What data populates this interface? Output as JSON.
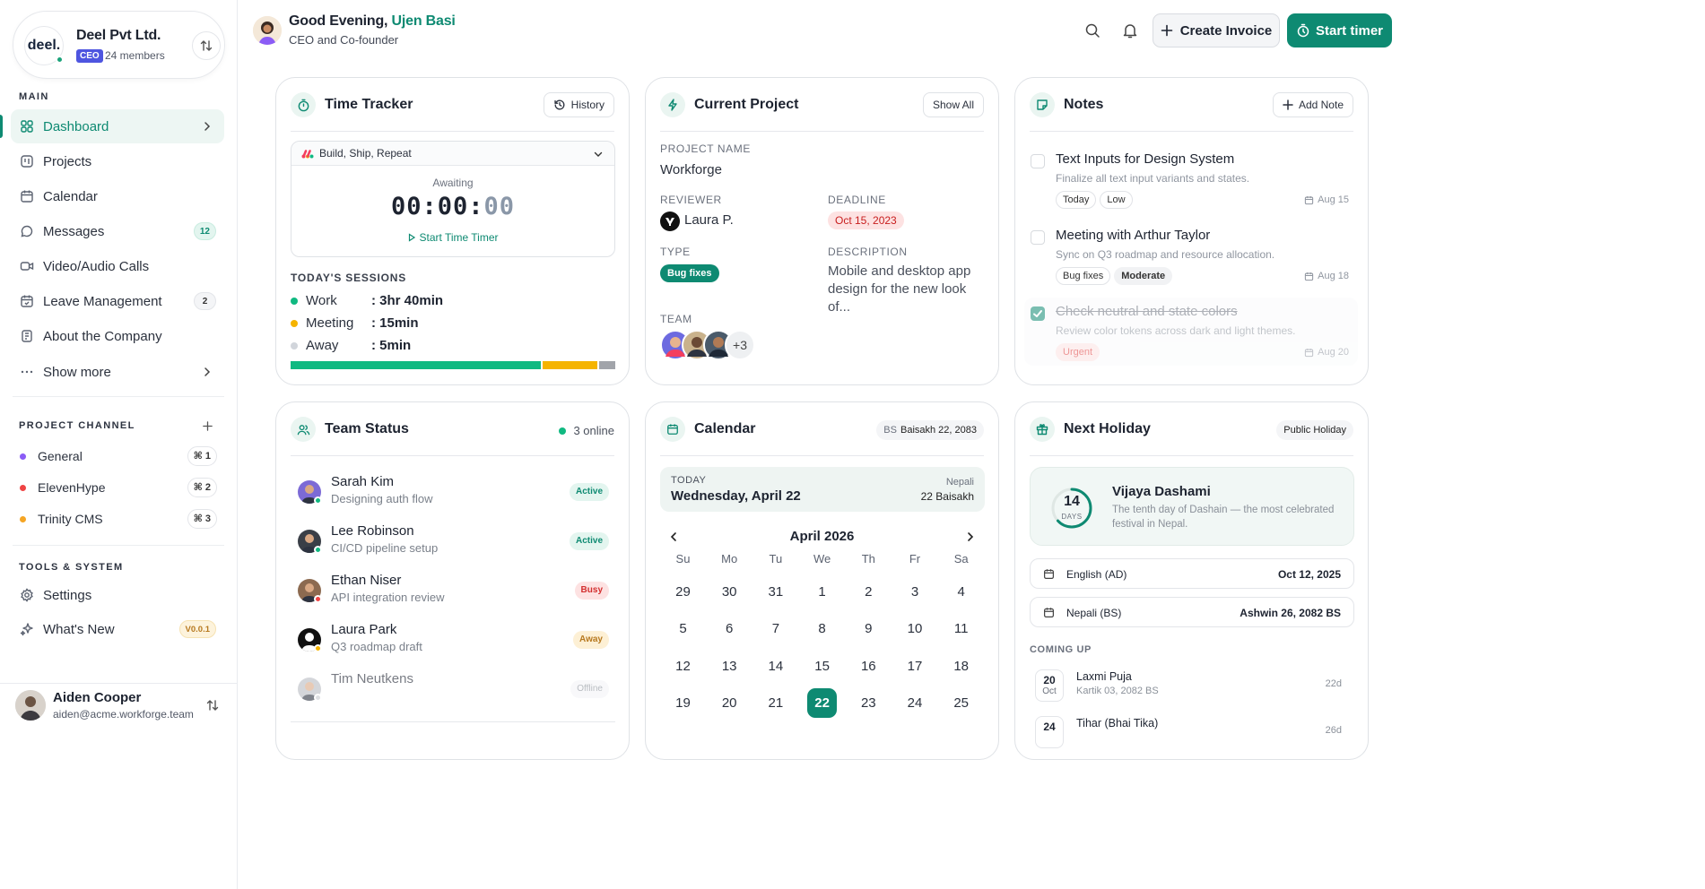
{
  "org": {
    "logo_text": "deel.",
    "name": "Deel Pvt Ltd.",
    "role": "CEO",
    "members": "24 members"
  },
  "sidebar": {
    "main_title": "MAIN",
    "items": [
      {
        "label": "Dashboard",
        "icon": "grid-icon",
        "active": true
      },
      {
        "label": "Projects",
        "icon": "projects-icon"
      },
      {
        "label": "Calendar",
        "icon": "calendar-icon"
      },
      {
        "label": "Messages",
        "icon": "message-icon",
        "badge": "12"
      },
      {
        "label": "Video/Audio Calls",
        "icon": "video-icon"
      },
      {
        "label": "Leave Management",
        "icon": "leave-icon",
        "badge": "2"
      },
      {
        "label": "About the Company",
        "icon": "building-icon"
      },
      {
        "label": "Show more",
        "icon": "more-icon"
      }
    ],
    "channel_title": "PROJECT CHANNEL",
    "channels": [
      {
        "label": "General",
        "color": "#8b5cf6",
        "shortcut": "⌘ 1"
      },
      {
        "label": "ElevenHype",
        "color": "#ef4444",
        "shortcut": "⌘ 2"
      },
      {
        "label": "Trinity CMS",
        "color": "#f5a524",
        "shortcut": "⌘ 3"
      }
    ],
    "tools_title": "TOOLS & SYSTEM",
    "tools": [
      {
        "label": "Settings",
        "icon": "settings-icon"
      },
      {
        "label": "What's New",
        "icon": "sparkle-icon",
        "badge": "V0.0.1"
      }
    ]
  },
  "user": {
    "name": "Aiden Cooper",
    "email": "aiden@acme.workforge.team"
  },
  "header": {
    "greeting": "Good Evening, ",
    "name": "Ujen Basi",
    "subtitle": "CEO and Co-founder",
    "create_invoice": "Create Invoice",
    "start_timer": "Start timer"
  },
  "time_tracker": {
    "title": "Time Tracker",
    "history": "History",
    "project": "Build, Ship, Repeat",
    "status": "Awaiting",
    "timer_main": "00:00:",
    "timer_sec": "00",
    "start_link": "Start Time Timer",
    "sessions_title": "TODAY'S SESSIONS",
    "sessions": [
      {
        "label": "Work",
        "value": ": 3hr 40min",
        "color": "#10b981",
        "fraction": 0.78
      },
      {
        "label": "Meeting",
        "value": ": 15min",
        "color": "#f5b400",
        "fraction": 0.17
      },
      {
        "label": "Away",
        "value": ": 5min",
        "color": "#d1d5db",
        "fraction": 0.05
      }
    ]
  },
  "current_project": {
    "title": "Current Project",
    "show_all": "Show All",
    "project_name_label": "PROJECT NAME",
    "project_name": "Workforge",
    "reviewer_label": "REVIEWER",
    "reviewer": "Laura P.",
    "deadline_label": "DEADLINE",
    "deadline": "Oct 15, 2023",
    "type_label": "TYPE",
    "type": "Bug fixes",
    "description_label": "DESCRIPTION",
    "description": "Mobile and desktop app design for the new look of...",
    "team_label": "TEAM",
    "team_more": "+3"
  },
  "notes": {
    "title": "Notes",
    "add": "Add Note",
    "items": [
      {
        "title": "Text Inputs for Design System",
        "desc": "Finalize all text input variants and states.",
        "tags": [
          "Today",
          "Low"
        ],
        "date": "Aug 15",
        "done": false
      },
      {
        "title": "Meeting with Arthur Taylor",
        "desc": "Sync on Q3 roadmap and resource allocation.",
        "tags": [
          "Bug fixes",
          "Moderate"
        ],
        "date": "Aug 18",
        "done": false
      },
      {
        "title": "Check neutral and state colors",
        "desc": "Review color tokens across dark and light themes.",
        "tags": [
          "Urgent"
        ],
        "date": "Aug 20",
        "done": true
      }
    ]
  },
  "team_status": {
    "title": "Team Status",
    "online": "3 online",
    "members": [
      {
        "name": "Sarah Kim",
        "task": "Designing auth flow",
        "status": "Active",
        "dot": "#10b981"
      },
      {
        "name": "Lee Robinson",
        "task": "CI/CD pipeline setup",
        "status": "Active",
        "dot": "#10b981"
      },
      {
        "name": "Ethan Niser",
        "task": "API integration review",
        "status": "Busy",
        "dot": "#ef4444"
      },
      {
        "name": "Laura Park",
        "task": "Q3 roadmap draft",
        "status": "Away",
        "dot": "#f5b400"
      },
      {
        "name": "Tim Neutkens",
        "task": "",
        "status": "Offline",
        "dot": "#c9ccd1"
      }
    ]
  },
  "calendar": {
    "title": "Calendar",
    "bs_label": "BS",
    "bs_date": "Baisakh 22, 2083",
    "today_label": "TODAY",
    "today_date": "Wednesday, April 22",
    "nepali_label": "Nepali",
    "nepali_date": "22 Baisakh",
    "month": "April 2026",
    "weekdays": [
      "Su",
      "Mo",
      "Tu",
      "We",
      "Th",
      "Fr",
      "Sa"
    ],
    "weeks": [
      [
        "29",
        "30",
        "31",
        "1",
        "2",
        "3",
        "4"
      ],
      [
        "5",
        "6",
        "7",
        "8",
        "9",
        "10",
        "11"
      ],
      [
        "12",
        "13",
        "14",
        "15",
        "16",
        "17",
        "18"
      ],
      [
        "19",
        "20",
        "21",
        "22",
        "23",
        "24",
        "25"
      ]
    ],
    "selected": "22"
  },
  "holiday": {
    "title": "Next Holiday",
    "badge": "Public Holiday",
    "days": "14",
    "days_label": "DAYS",
    "name": "Vijaya Dashami",
    "desc": "The tenth day of Dashain — the most celebrated festival in Nepal.",
    "english_label": "English (AD)",
    "english_date": "Oct 12, 2025",
    "nepali_label": "Nepali (BS)",
    "nepali_date": "Ashwin 26, 2082 BS",
    "coming_title": "COMING UP",
    "coming": [
      {
        "day": "20",
        "month": "Oct",
        "name": "Laxmi Puja",
        "bs": "Kartik 03, 2082 BS",
        "in": "22d"
      },
      {
        "day": "24",
        "month": "",
        "name": "Tihar (Bhai Tika)",
        "bs": "",
        "in": "26d"
      }
    ]
  },
  "colors": {
    "accent": "#0e8a72",
    "accent_light": "#eaf5f1"
  }
}
